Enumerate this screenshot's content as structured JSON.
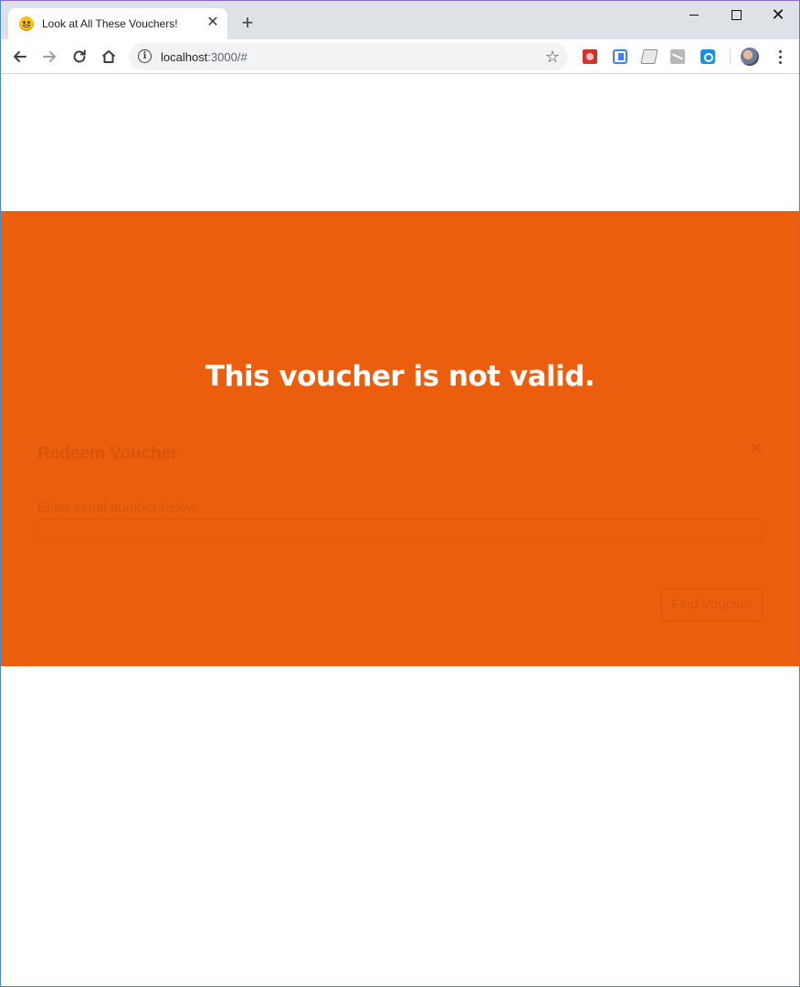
{
  "browser": {
    "tab": {
      "title": "Look at All These Vouchers!",
      "close_glyph": "✕",
      "favicon": "grinning-face-icon"
    },
    "new_tab_glyph": "+",
    "window_controls": {
      "close_glyph": "✕"
    },
    "nav": {
      "back_glyph": "←",
      "forward_glyph": "→",
      "reload_glyph": "↻",
      "home_glyph": "⌂"
    },
    "address_bar": {
      "info_glyph": "i",
      "host": "localhost",
      "rest": ":3000/#",
      "star_glyph": "☆"
    },
    "extensions": [
      "red-extension-icon",
      "blue-extension-icon",
      "gray-extension-icon",
      "pen-extension-icon",
      "blue-clock-extension-icon"
    ]
  },
  "page": {
    "background": "#ffffff",
    "overlay_color": "#ea5e0e",
    "alert": {
      "message": "This voucher is not valid."
    },
    "modal": {
      "title": "Redeem Voucher",
      "close_glyph": "×",
      "serial_label": "Enter serial number below",
      "serial_value": "",
      "find_button_label": "Find Voucher"
    }
  }
}
